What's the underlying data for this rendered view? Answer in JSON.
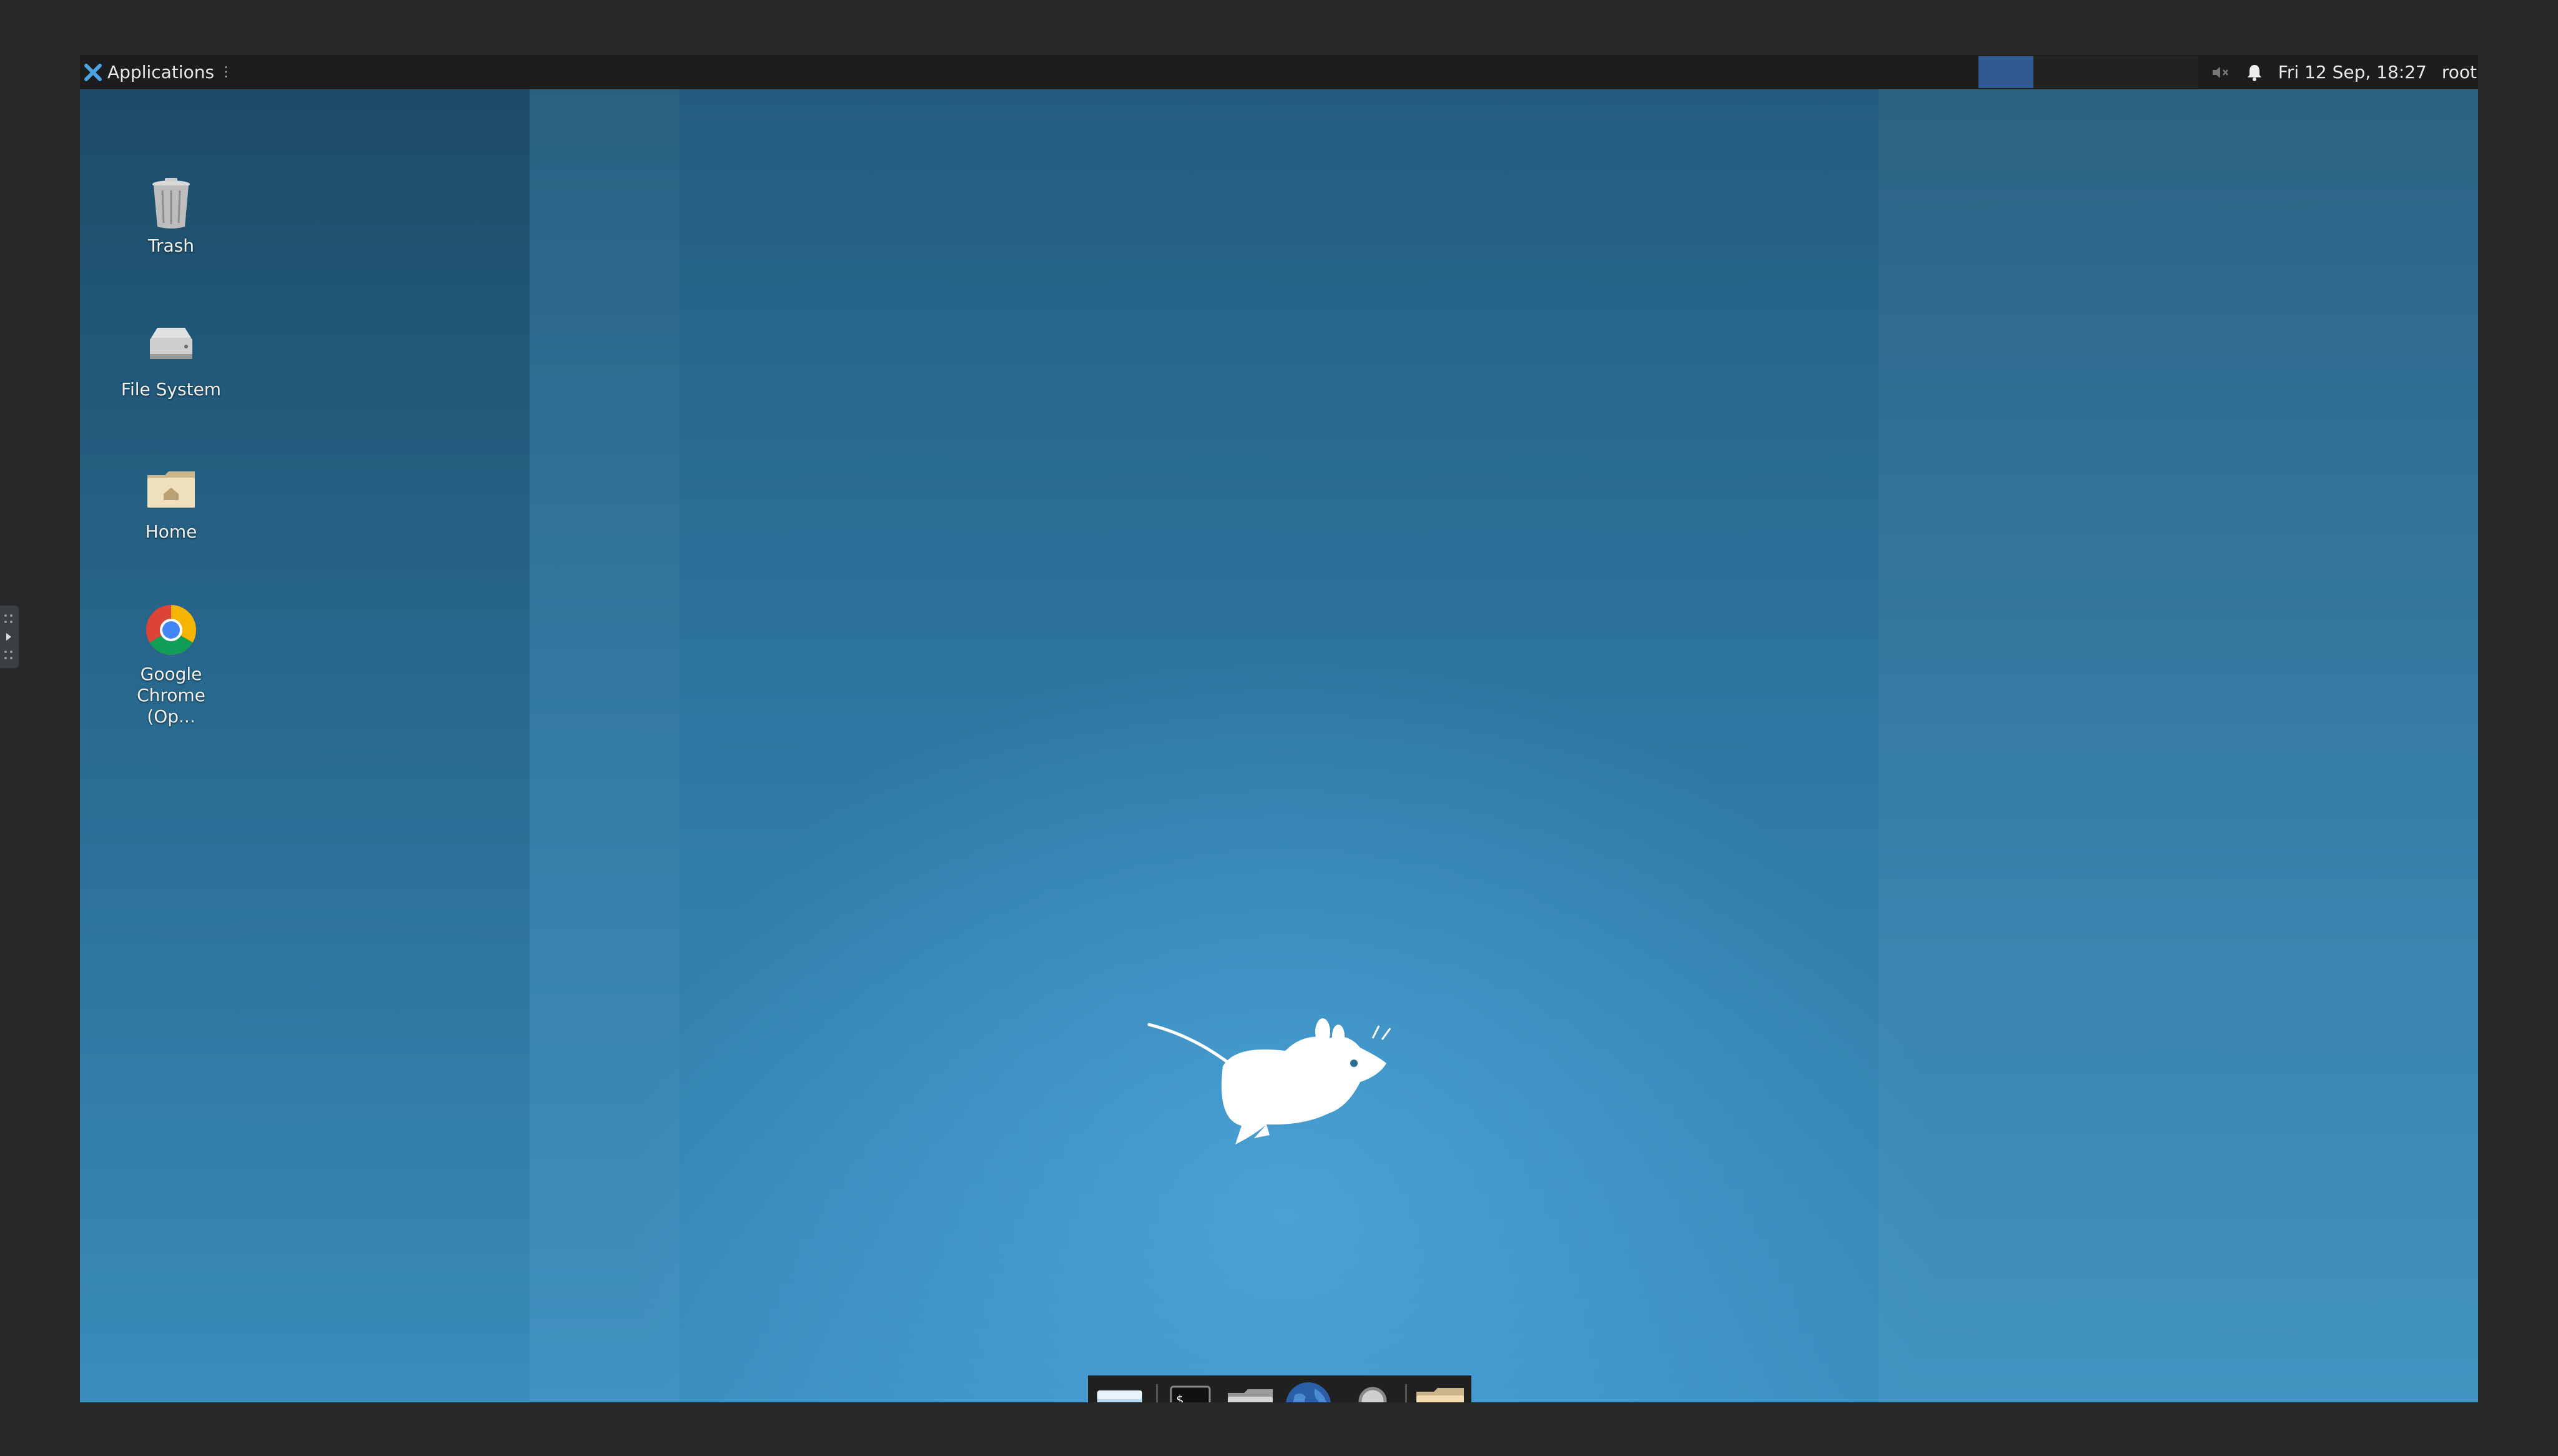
{
  "panel": {
    "apps_label": "Applications",
    "clock": "Fri 12 Sep, 18:27",
    "user": "root",
    "workspaces": 4
  },
  "desktop_icons": [
    {
      "label": "Trash",
      "icon": "trash-icon"
    },
    {
      "label": "File System",
      "icon": "drive-icon"
    },
    {
      "label": "Home",
      "icon": "home-folder-icon"
    },
    {
      "label": "Google Chrome (Op...",
      "icon": "chrome-icon"
    }
  ],
  "dock": [
    {
      "name": "show-desktop",
      "icon": "window-icon"
    },
    {
      "name": "terminal",
      "icon": "terminal-icon",
      "text": "$_"
    },
    {
      "name": "file-manager",
      "icon": "home-folder-icon"
    },
    {
      "name": "web-browser",
      "icon": "globe-icon"
    },
    {
      "name": "app-finder",
      "icon": "magnifier-icon"
    },
    {
      "name": "folder",
      "icon": "folder-icon"
    }
  ],
  "colors": {
    "panel": "#1d1d1d",
    "desktop": "#2e6f96",
    "workspace_active": "#2f5a92"
  }
}
